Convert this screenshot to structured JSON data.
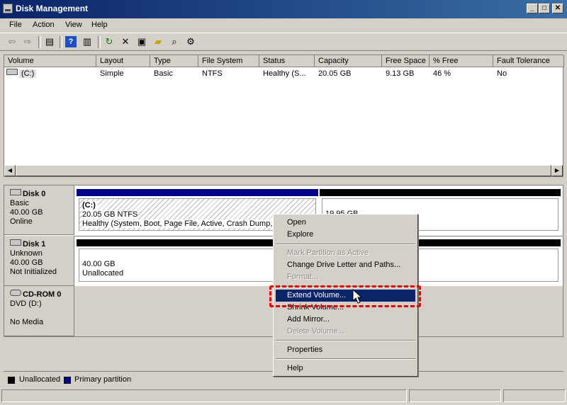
{
  "window": {
    "title": "Disk Management"
  },
  "menubar": [
    "File",
    "Action",
    "View",
    "Help"
  ],
  "columns": [
    "Volume",
    "Layout",
    "Type",
    "File System",
    "Status",
    "Capacity",
    "Free Space",
    "% Free",
    "Fault Tolerance"
  ],
  "volumes": [
    {
      "volume": "(C:)",
      "layout": "Simple",
      "type": "Basic",
      "fs": "NTFS",
      "status": "Healthy (S...",
      "capacity": "20.05 GB",
      "free": "9.13 GB",
      "pct": "46 %",
      "fault": "No"
    }
  ],
  "disks": [
    {
      "name": "Disk 0",
      "type": "Basic",
      "size": "40.00 GB",
      "state": "Online"
    },
    {
      "name": "Disk 1",
      "type": "Unknown",
      "size": "40.00 GB",
      "state": "Not Initialized"
    },
    {
      "name": "CD-ROM 0",
      "type": "DVD (D:)",
      "size": "",
      "state": "No Media"
    }
  ],
  "partitions": {
    "disk0_c": {
      "title": "(C:)",
      "size": "20.05 GB NTFS",
      "status": "Healthy (System, Boot, Page File, Active, Crash Dump, P"
    },
    "disk0_unalloc": {
      "size": "19.95 GB"
    },
    "disk1_unalloc": {
      "size": "40.00 GB",
      "status": "Unallocated"
    }
  },
  "legend": [
    {
      "label": "Unallocated",
      "color": "#000000"
    },
    {
      "label": "Primary partition",
      "color": "#00008b"
    }
  ],
  "context_menu": {
    "groups": [
      [
        {
          "label": "Open",
          "enabled": true
        },
        {
          "label": "Explore",
          "enabled": true
        }
      ],
      [
        {
          "label": "Mark Partition as Active",
          "enabled": false
        },
        {
          "label": "Change Drive Letter and Paths...",
          "enabled": true
        },
        {
          "label": "Format...",
          "enabled": false
        }
      ],
      [
        {
          "label": "Extend Volume...",
          "enabled": true,
          "highlighted": true
        },
        {
          "label": "Shrink Volume...",
          "enabled": true
        },
        {
          "label": "Add Mirror...",
          "enabled": true
        },
        {
          "label": "Delete Volume...",
          "enabled": false
        }
      ],
      [
        {
          "label": "Properties",
          "enabled": true
        }
      ],
      [
        {
          "label": "Help",
          "enabled": true
        }
      ]
    ]
  },
  "colors": {
    "primary_partition": "#00008b",
    "unallocated": "#000000",
    "highlight_border": "#e00000",
    "menu_highlight": "#0a246a"
  }
}
